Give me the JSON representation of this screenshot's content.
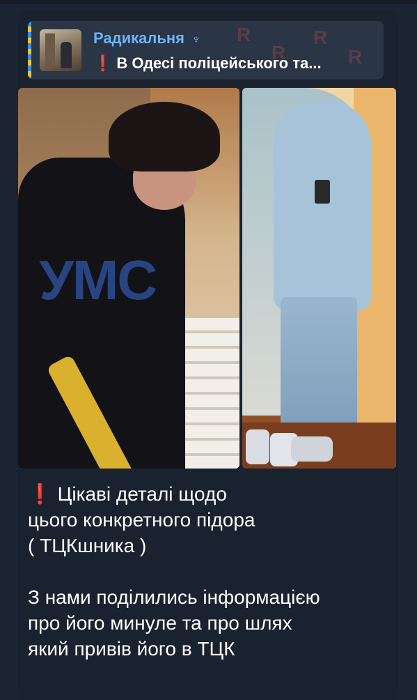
{
  "reply": {
    "channel_name": "Радикальня",
    "channel_symbol": "♆",
    "preview_marker": "❗",
    "preview_text": "В Одесі поліцейського та..."
  },
  "photos": {
    "left_watermark": "УМС"
  },
  "message": {
    "marker": "❗",
    "text": "Цікаві деталі щодо\nцього конкретного підора\n( ТЦКшника )\n\nЗ нами поділились інформацією\nпро його минуле та про шлях\nякий привів його в ТЦК"
  },
  "colors": {
    "background": "#1b2431",
    "bubble": "#1a2230",
    "reply_bg": "#2a3545",
    "accent_blue": "#6fb3f7",
    "alert_red": "#d9302c"
  }
}
